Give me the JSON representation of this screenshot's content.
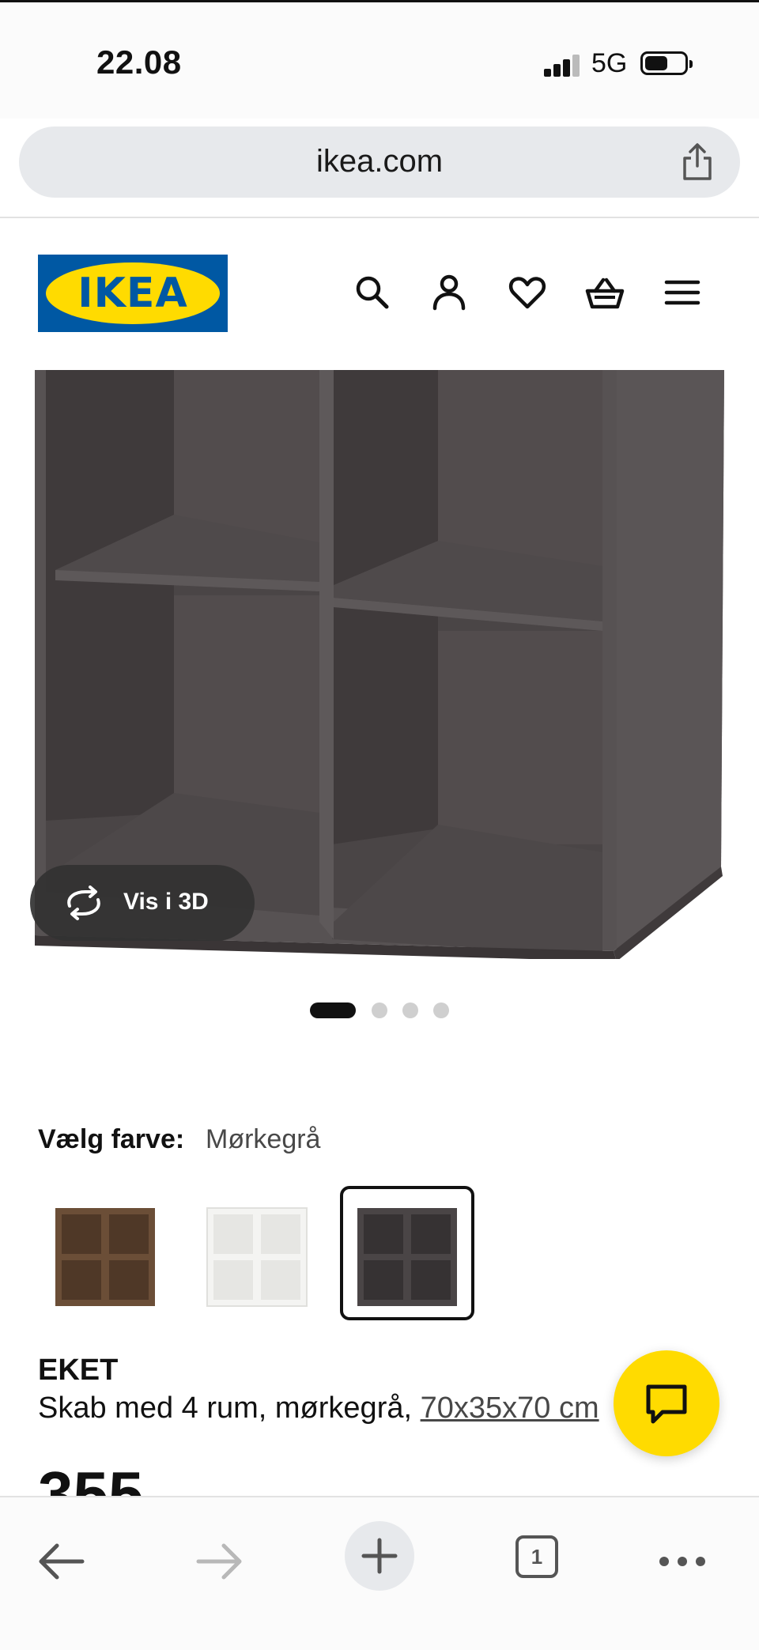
{
  "status_bar": {
    "time": "22.08",
    "network": "5G"
  },
  "browser": {
    "url": "ikea.com",
    "tab_count": "1"
  },
  "brand": {
    "logo_text": "IKEA",
    "logo_mark": "®",
    "colors": {
      "blue": "#0058a3",
      "yellow": "#ffdb00"
    }
  },
  "header_icons": [
    "search-icon",
    "account-icon",
    "heart-icon",
    "basket-icon",
    "menu-icon"
  ],
  "gallery": {
    "view_3d_label": "Vis i 3D",
    "pages": 4,
    "active_page": 1
  },
  "color_selector": {
    "label": "Vælg farve:",
    "selected_value": "Mørkegrå",
    "options": [
      {
        "color": "#6b4e37",
        "selected": false
      },
      {
        "color": "#f4f4f2",
        "selected": false
      },
      {
        "color": "#4a4546",
        "selected": true
      }
    ]
  },
  "product": {
    "name": "EKET",
    "description": "Skab med 4 rum, mørkegrå, ",
    "dimensions": "70x35x70 cm",
    "price": "355"
  }
}
